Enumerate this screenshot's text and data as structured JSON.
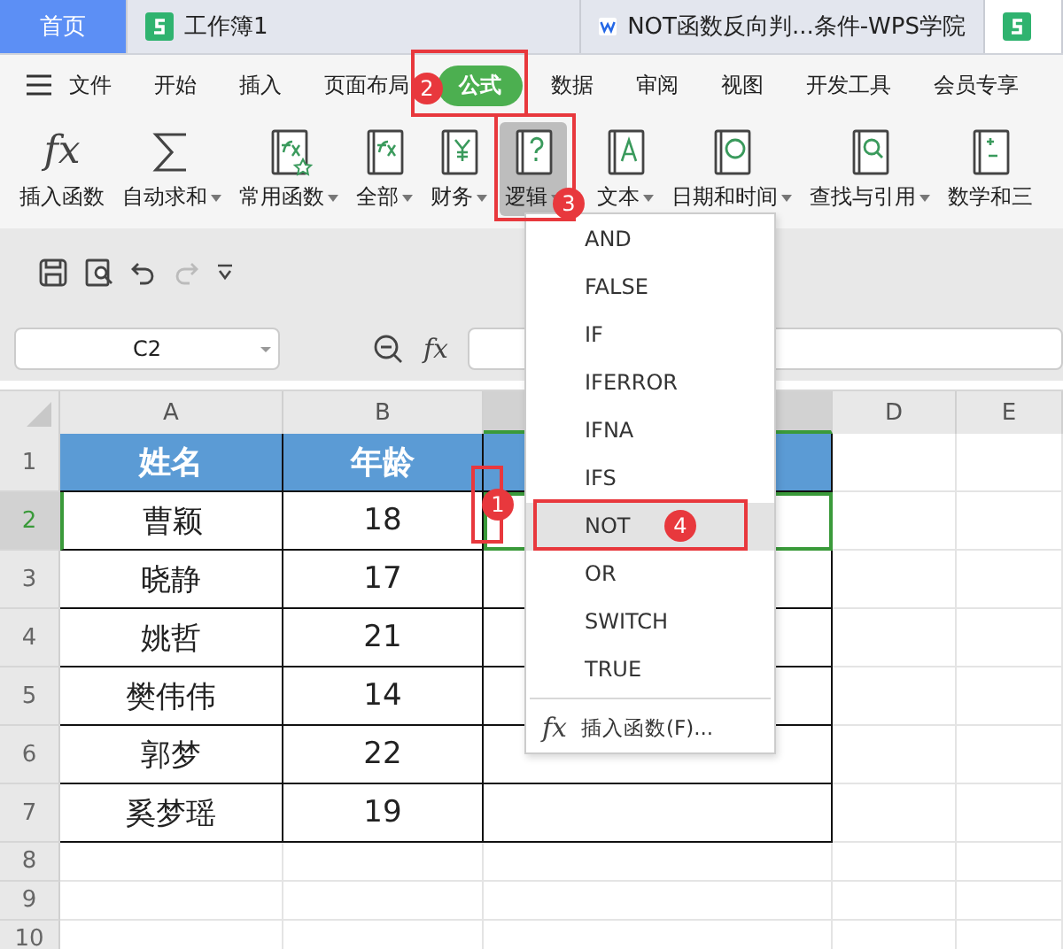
{
  "tabs": [
    {
      "label": "首页",
      "kind": "home",
      "selected": false
    },
    {
      "label": "工作簿1",
      "kind": "sheet",
      "selected": false
    },
    {
      "label": "NOT函数反向判...条件-WPS学院",
      "kind": "web",
      "selected": false
    },
    {
      "kind": "sheet",
      "selected": true
    }
  ],
  "menu": [
    {
      "label": "文件",
      "kind": "file",
      "selected": false
    },
    {
      "label": "开始",
      "selected": false
    },
    {
      "label": "插入",
      "selected": false
    },
    {
      "label": "页面布局",
      "selected": false
    },
    {
      "label": "公式",
      "selected": true
    },
    {
      "label": "数据",
      "selected": false
    },
    {
      "label": "审阅",
      "selected": false
    },
    {
      "label": "视图",
      "selected": false
    },
    {
      "label": "开发工具",
      "selected": false
    },
    {
      "label": "会员专享",
      "selected": false
    }
  ],
  "ribbon": [
    {
      "label": "插入函数",
      "kind": "symbol",
      "symbol": "fx",
      "dropdown": false,
      "selected": false
    },
    {
      "label": "自动求和",
      "kind": "sum",
      "dropdown": true,
      "selected": false
    },
    {
      "label": "常用函数",
      "kind": "star",
      "dropdown": true,
      "selected": false
    },
    {
      "label": "全部",
      "kind": "fxbook",
      "dropdown": true,
      "selected": false
    },
    {
      "label": "财务",
      "kind": "yen",
      "dropdown": true,
      "selected": false
    },
    {
      "label": "逻辑",
      "kind": "question",
      "dropdown": true,
      "selected": true
    },
    {
      "label": "文本",
      "kind": "text",
      "dropdown": true,
      "selected": false
    },
    {
      "label": "日期和时间",
      "kind": "clock",
      "dropdown": true,
      "selected": false
    },
    {
      "label": "查找与引用",
      "kind": "search",
      "dropdown": true,
      "selected": false
    },
    {
      "label": "数学和三",
      "kind": "math",
      "dropdown": false,
      "selected": false
    }
  ],
  "formula_bar": {
    "name_box": "C2",
    "fx": "fx"
  },
  "sheet": {
    "columns": [
      {
        "label": "A",
        "selected": false
      },
      {
        "label": "B",
        "selected": false
      },
      {
        "selected": true
      },
      {
        "label": "D",
        "selected": false
      },
      {
        "label": "E",
        "selected": false
      }
    ],
    "rows": [
      {
        "number": "1",
        "selected": false,
        "cells": [
          "姓名",
          "年龄"
        ],
        "kind": "header"
      },
      {
        "number": "2",
        "selected": true,
        "cells": [
          "曹颖",
          "18"
        ]
      },
      {
        "number": "3",
        "selected": false,
        "cells": [
          "晓静",
          "17"
        ]
      },
      {
        "number": "4",
        "selected": false,
        "cells": [
          "姚哲",
          "21"
        ]
      },
      {
        "number": "5",
        "selected": false,
        "cells": [
          "樊伟伟",
          "14"
        ]
      },
      {
        "number": "6",
        "selected": false,
        "cells": [
          "郭梦",
          "22"
        ]
      },
      {
        "number": "7",
        "selected": false,
        "cells": [
          "奚梦瑶",
          "19"
        ]
      },
      {
        "number": "8",
        "selected": false,
        "cells": []
      },
      {
        "number": "9",
        "selected": false,
        "cells": []
      },
      {
        "number": "10",
        "selected": false,
        "cells": []
      }
    ]
  },
  "dropdown": {
    "items": [
      {
        "label": "AND",
        "selected": false
      },
      {
        "label": "FALSE",
        "selected": false
      },
      {
        "label": "IF",
        "selected": false
      },
      {
        "label": "IFERROR",
        "selected": false
      },
      {
        "label": "IFNA",
        "selected": false
      },
      {
        "label": "IFS",
        "selected": false
      },
      {
        "label": "NOT",
        "selected": true
      },
      {
        "label": "OR",
        "selected": false
      },
      {
        "label": "SWITCH",
        "selected": false
      },
      {
        "label": "TRUE",
        "selected": false
      }
    ],
    "footer_symbol": "fx",
    "footer": "插入函数(F)..."
  },
  "markers": [
    {
      "number": "1"
    },
    {
      "number": "2"
    },
    {
      "number": "3"
    },
    {
      "number": "4"
    }
  ]
}
